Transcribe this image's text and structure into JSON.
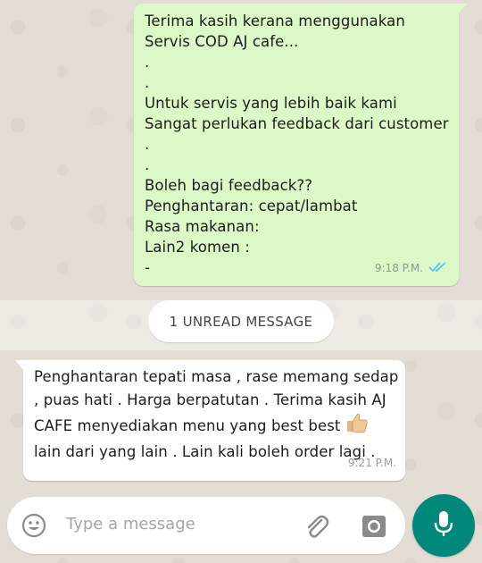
{
  "outgoing": {
    "text": "Terima kasih kerana menggunakan\nServis COD AJ cafe...\n.\n.\nUntuk servis yang lebih baik kami\nSangat perlukan feedback dari customer\n.\n.\nBoleh bagi feedback??\nPenghantaran: cepat/lambat\nRasa makanan:\nLain2 komen :\n-",
    "time": "9:18 P.M.",
    "status_icon": "double-check-read-icon"
  },
  "unread": {
    "label": "1 UNREAD MESSAGE"
  },
  "incoming": {
    "text_before_emoji": "Penghantaran tepati masa , rase memang sedap , puas hati . Harga berpatutan . Terima kasih AJ CAFE menyediakan menu yang best best",
    "emoji": "thumbs-up-icon",
    "text_after_emoji": "lain dari yang lain . Lain kali boleh order lagi .",
    "time": "9:21 P.M."
  },
  "composer": {
    "placeholder": "Type a message",
    "emoji_icon": "emoji-icon",
    "attach_icon": "paperclip-icon",
    "camera_icon": "camera-icon",
    "mic_icon": "microphone-icon"
  },
  "colors": {
    "outgoing_bubble": "#dcf8c6",
    "incoming_bubble": "#ffffff",
    "accent": "#00897b",
    "read_ticks": "#4fc3f7"
  }
}
